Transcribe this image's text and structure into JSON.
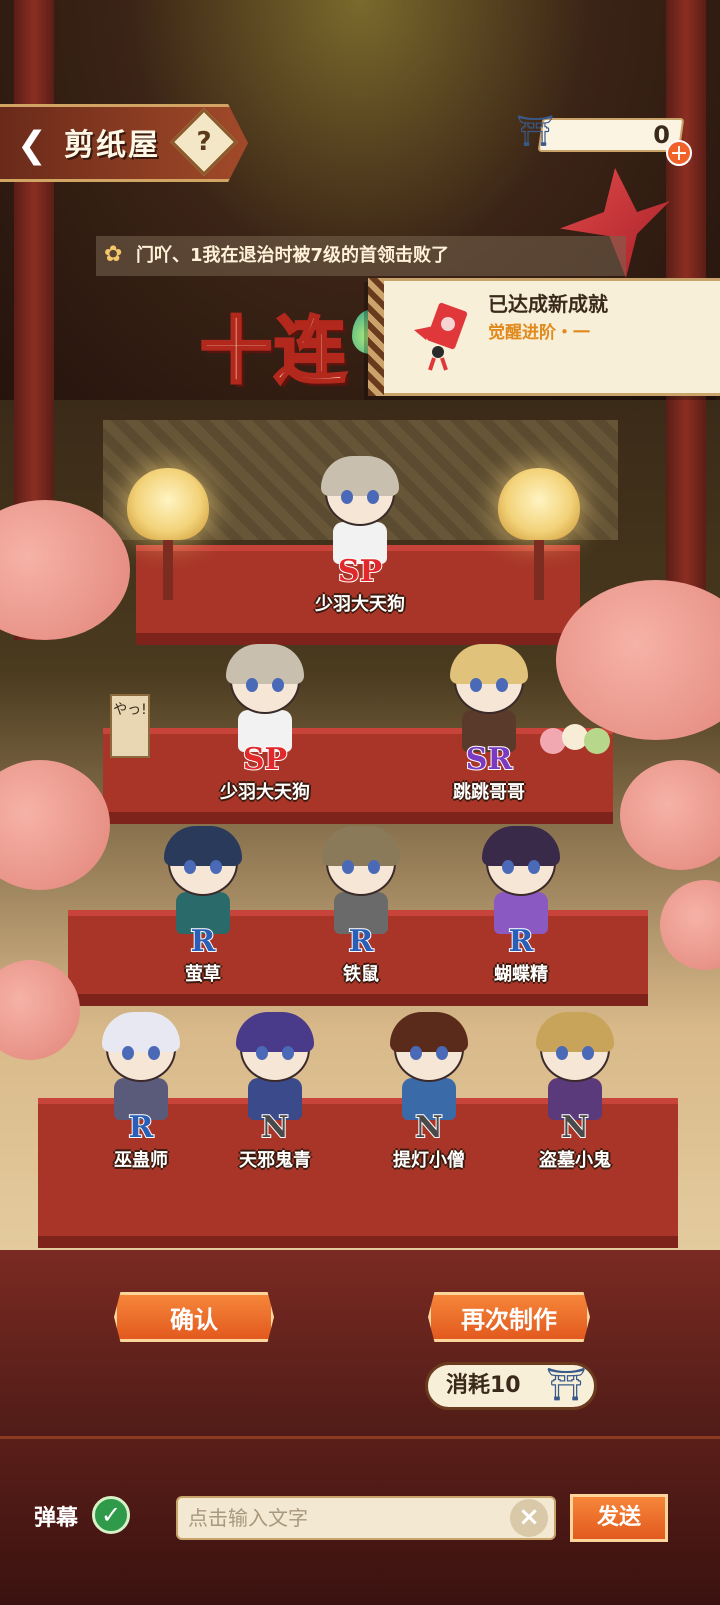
{
  "header": {
    "back_icon": "chevron-left-icon",
    "title": "剪纸屋",
    "help_label": "?",
    "currency_icon": "paper-doll-icon",
    "currency_value": "0",
    "plus_label": "+"
  },
  "ticker": {
    "text": "门吖、1我在退治时被7级的首领击败了"
  },
  "banner": {
    "ten_pull": "十连"
  },
  "toast": {
    "title": "已达成新成就",
    "subtitle": "觉醒进阶・一"
  },
  "decor": {
    "tag_text": "やっ!"
  },
  "results": [
    {
      "rarity": "SP",
      "name": "少羽大天狗",
      "hair": "#c9bfae",
      "torso": "#f2f2f2"
    },
    {
      "rarity": "SP",
      "name": "少羽大天狗",
      "hair": "#c9bfae",
      "torso": "#f2f2f2"
    },
    {
      "rarity": "SR",
      "name": "跳跳哥哥",
      "hair": "#e0c27a",
      "torso": "#5a3a2a"
    },
    {
      "rarity": "R",
      "name": "萤草",
      "hair": "#2a3a5a",
      "torso": "#2a6a6a"
    },
    {
      "rarity": "R",
      "name": "铁鼠",
      "hair": "#8a7a5a",
      "torso": "#6a6a6a"
    },
    {
      "rarity": "R",
      "name": "蝴蝶精",
      "hair": "#3a2a4a",
      "torso": "#8a5ac2"
    },
    {
      "rarity": "R",
      "name": "巫蛊师",
      "hair": "#e8e8f2",
      "torso": "#5a5a7a"
    },
    {
      "rarity": "N",
      "name": "天邪鬼青",
      "hair": "#4a3a8a",
      "torso": "#3a4a8a"
    },
    {
      "rarity": "N",
      "name": "提灯小僧",
      "hair": "#5a2a1a",
      "torso": "#3a6aa8"
    },
    {
      "rarity": "N",
      "name": "盗墓小鬼",
      "hair": "#c8a45a",
      "torso": "#5a3a7a"
    }
  ],
  "actions": {
    "confirm_label": "确认",
    "again_label": "再次制作",
    "cost_label": "消耗10",
    "cost_icon": "paper-doll-icon"
  },
  "chat": {
    "danmu_label": "弹幕",
    "danmu_enabled": true,
    "input_value": "",
    "input_placeholder": "点击输入文字",
    "clear_icon": "close-icon",
    "send_label": "发送"
  },
  "colors": {
    "accent": "#e25a1e",
    "stage_red": "#a83528",
    "toast_sub": "#e08a1e"
  }
}
